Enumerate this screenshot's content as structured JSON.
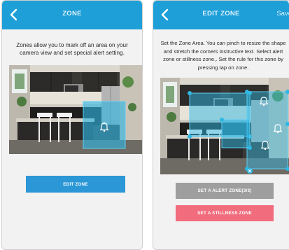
{
  "left_screen": {
    "title": "ZONE",
    "description": "Zones allow you to mark off an area on your camera view and set special alert setting.",
    "edit_button_label": "EDIT ZONE"
  },
  "right_screen": {
    "title": "EDIT ZONE",
    "action_label": "Save",
    "instructions": "Set the Zone Area. You can pinch to resize the shape and stretch the corners instructive text. Select alert zone or stillness zone,. Set the rule for this zone by pressing tap on zone.",
    "alert_zone_button_label": "SET A ALERT ZONE(3/3)",
    "stillness_zone_button_label": "SET A STILLNESS ZONE"
  },
  "colors": {
    "header": "#1e9fd8",
    "primary_button": "#2b97d6",
    "disabled_button": "#9e9e9e",
    "stillness_button": "#f16c7c",
    "zone_fill": "#2fb7e4"
  },
  "icons": [
    "back-icon",
    "bell-icon",
    "close-icon"
  ]
}
